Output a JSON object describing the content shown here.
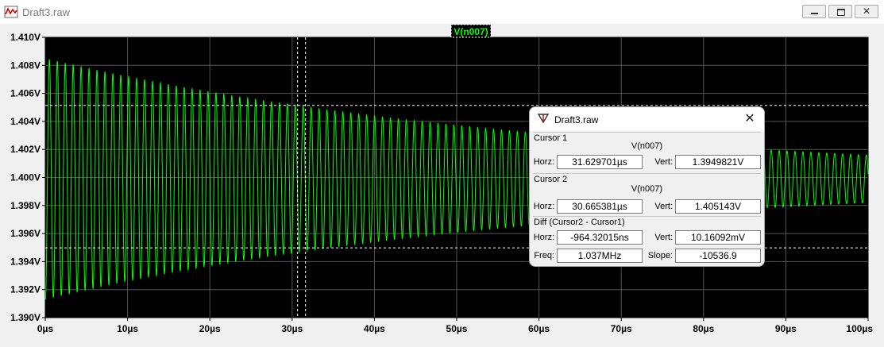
{
  "window": {
    "title": "Draft3.raw"
  },
  "chart_data": {
    "type": "line",
    "title": "V(n007)",
    "xlim": [
      0,
      100
    ],
    "ylim": [
      1.39,
      1.41
    ],
    "x_ticks": [
      "0µs",
      "10µs",
      "20µs",
      "30µs",
      "40µs",
      "50µs",
      "60µs",
      "70µs",
      "80µs",
      "90µs",
      "100µs"
    ],
    "y_ticks": [
      "1.410V",
      "1.408V",
      "1.406V",
      "1.404V",
      "1.402V",
      "1.400V",
      "1.398V",
      "1.396V",
      "1.394V",
      "1.392V",
      "1.390V"
    ],
    "series": [
      {
        "name": "V(n007)",
        "color": "#00ff00",
        "center": 1.3999,
        "amplitude_start": 0.0086,
        "amplitude_end": 0.0017,
        "period_us": 0.964,
        "peak_time_us": 0.5
      }
    ],
    "cursor1": {
      "x": 31.629701,
      "y": 1.3949821
    },
    "cursor2": {
      "x": 30.665381,
      "y": 1.405143
    },
    "background": "#000000",
    "grid_color": "#555555"
  },
  "dialog": {
    "title": "Draft3.raw",
    "cursor1": {
      "title": "Cursor 1",
      "signal": "V(n007)",
      "horz_label": "Horz:",
      "horz": "31.629701µs",
      "vert_label": "Vert:",
      "vert": "1.3949821V"
    },
    "cursor2": {
      "title": "Cursor 2",
      "signal": "V(n007)",
      "horz_label": "Horz:",
      "horz": "30.665381µs",
      "vert_label": "Vert:",
      "vert": "1.405143V"
    },
    "diff": {
      "title": "Diff (Cursor2 - Cursor1)",
      "horz_label": "Horz:",
      "horz": "-964.32015ns",
      "vert_label": "Vert:",
      "vert": "10.16092mV",
      "freq_label": "Freq:",
      "freq": "1.037MHz",
      "slope_label": "Slope:",
      "slope": "-10536.9"
    }
  }
}
